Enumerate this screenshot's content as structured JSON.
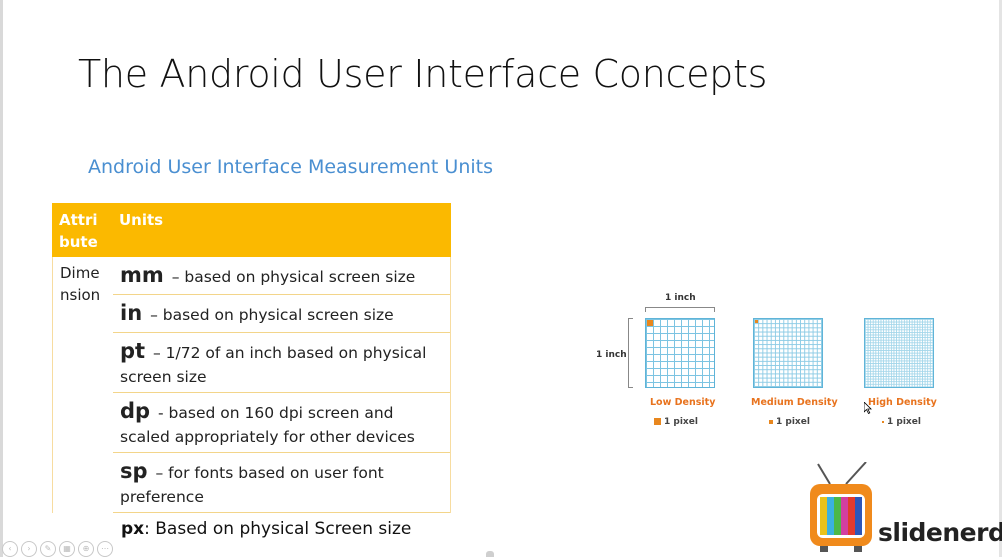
{
  "slide": {
    "title": "The Android User Interface Concepts",
    "subtitle": "Android User Interface Measurement Units"
  },
  "table": {
    "header_attribute": "Attri bute",
    "header_units": "Units",
    "attribute": "Dime nsion",
    "rows": [
      {
        "term": "mm",
        "desc": " – based on physical screen size"
      },
      {
        "term": "in",
        "desc": " – based on physical screen size"
      },
      {
        "term": "pt",
        "desc": " – 1/72 of an inch based on physical screen size"
      },
      {
        "term": "dp",
        "desc": " -  based on 160 dpi screen and scaled appropriately for other devices"
      },
      {
        "term": "sp",
        "desc": " – for fonts based on user font preference"
      }
    ],
    "extra": {
      "term": "px",
      "desc": ": Based on physical Screen size"
    }
  },
  "density_diagram": {
    "inch_top": "1 inch",
    "inch_left": "1 inch",
    "labels": [
      "Low Density",
      "Medium Density",
      "High Density"
    ],
    "pixel_label": "1 pixel",
    "pixel_color": "#e8871e",
    "grid_color": "#5fb4d8"
  },
  "logo": {
    "text": "slidenerd"
  },
  "toolbar": {
    "icons": [
      "prev-icon",
      "next-icon",
      "pen-icon",
      "slides-icon",
      "zoom-icon",
      "more-icon"
    ]
  }
}
